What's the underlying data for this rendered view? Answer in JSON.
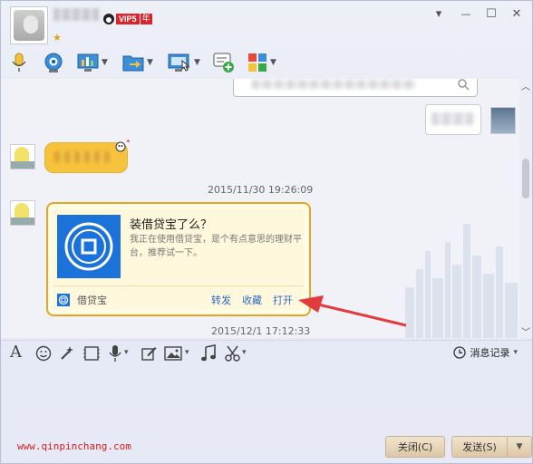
{
  "title_bar": {
    "vip_label": "VIP5",
    "vip_year": "年",
    "star": "★",
    "minimize_glyph": "▾",
    "restore_glyph": "—",
    "maximize_glyph": "☐",
    "close_glyph": "✕"
  },
  "top_toolbar": {
    "icons": [
      "microphone-icon",
      "video-call-icon",
      "remote-desktop-icon",
      "file-transfer-icon",
      "screen-share-icon",
      "invite-icon",
      "apps-icon"
    ]
  },
  "chat": {
    "timestamp_1": "2015/11/30 19:26:09",
    "timestamp_2": "2015/12/1 17:12:33",
    "card": {
      "title": "装借贷宝了么？",
      "description": "我正在使用借贷宝，是个有点意思的理财平台，推荐试一下。",
      "brand": "借贷宝",
      "forward": "转发",
      "favorite": "收藏",
      "open": "打开"
    }
  },
  "bottom_toolbar": {
    "history_label": "消息记录",
    "caret": "▾"
  },
  "footer": {
    "url": "www.qinpinchang.com",
    "close_button": "关闭(C)",
    "send_button": "发送(S)",
    "send_menu_glyph": "▼"
  },
  "colors": {
    "accent_blue": "#1b72d9",
    "card_border": "#e6a521",
    "arrow_red": "#e23b3b",
    "link_blue": "#2d6bbf"
  }
}
